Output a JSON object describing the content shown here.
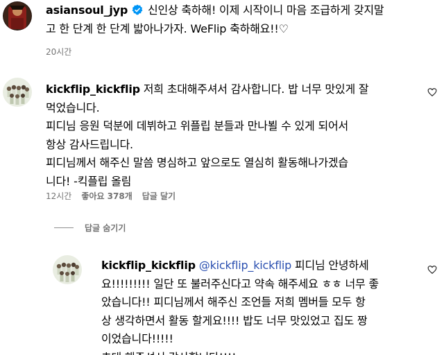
{
  "comments": [
    {
      "username": "asiansoul_jyp",
      "verified": true,
      "text": "신인상 축하해! 이제 시작이니 마음 조급하게 갖지말",
      "text_lines": [
        "신인상 축하해! 이제 시작이니 마음 조급하게 갖지말",
        "고 한 단계 한 단계 밟아나가자. WeFlip 축하해요!!♡"
      ],
      "time": "20시간"
    },
    {
      "username": "kickflip_kickflip",
      "text_lines": [
        "저희 초대해주셔서 감사합니다. 밥 너무 맛있게 잘",
        "먹었습니다.",
        "피디님 응원 덕분에 데뷔하고 위플립 분들과 만나뵐 수 있게 되어서",
        "항상 감사드립니다.",
        "피디님께서 해주신 말씀 명심하고 앞으로도 열심히 활동해나가겠습",
        "니다! -킥플립 올림"
      ],
      "time": "12시간",
      "likes": "좋아요 378개",
      "reply_label": "답글 달기"
    }
  ],
  "hide_replies_label": "답글 숨기기",
  "reply": {
    "username": "kickflip_kickflip",
    "mention": "@kickflip_kickflip",
    "text_lines": [
      " 피디님 안녕하세",
      "요!!!!!!!!! 일단 또 불러주신다고 약속 해주세요 ㅎㅎ 너무 좋",
      "았습니다!! 피디님께서 해주신 조언들 저희 멤버들 모두 항",
      "상 생각하면서 활동 할게요!!!! 밥도 너무 맛있었고 집도 짱",
      "이었습니다!!!!!",
      "초대 해주셔서 감사합니다!!!!"
    ]
  },
  "icons": {
    "verified": "verified-badge-icon",
    "like": "heart-outline-icon"
  },
  "colors": {
    "verified_blue": "#0095f6",
    "meta_gray": "#737373",
    "mention_blue": "#2a4fb0"
  }
}
